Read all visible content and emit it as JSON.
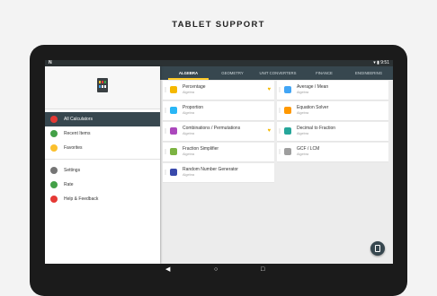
{
  "headline": "TABLET SUPPORT",
  "statusbar": {
    "left": "N",
    "right": "▾ ▮ 9:51"
  },
  "drawer": {
    "items": [
      {
        "label": "All Calculators",
        "icon": "calculator-icon",
        "color": "#e53935"
      },
      {
        "label": "Recent Items",
        "icon": "clock-icon",
        "color": "#43a047"
      },
      {
        "label": "Favorites",
        "icon": "heart-icon",
        "color": "#fbc02d"
      },
      {
        "label": "Settings",
        "icon": "gear-icon",
        "color": "#757575"
      },
      {
        "label": "Rate",
        "icon": "play-store-icon",
        "color": "#43a047"
      },
      {
        "label": "Help & Feedback",
        "icon": "lifebuoy-icon",
        "color": "#e53935"
      }
    ]
  },
  "tabs": [
    "ALGEBRA",
    "GEOMETRY",
    "UNIT CONVERTERS",
    "FINANCE",
    "ENGINEERING"
  ],
  "cards": [
    {
      "title": "Percentage",
      "sub": "Algebra",
      "icon": "percentage-tag-icon",
      "color": "#f5b800",
      "fav": "♥"
    },
    {
      "title": "Average / Mean",
      "sub": "Algebra",
      "icon": "bar-chart-icon",
      "color": "#42a5f5",
      "fav": ""
    },
    {
      "title": "Proportion",
      "sub": "Algebra",
      "icon": "proportion-icon",
      "color": "#29b6f6",
      "fav": ""
    },
    {
      "title": "Equation Solver",
      "sub": "Algebra",
      "icon": "clipboard-icon",
      "color": "#ff9800",
      "fav": ""
    },
    {
      "title": "Combinations / Permutations",
      "sub": "Algebra",
      "icon": "shapes-icon",
      "color": "#ab47bc",
      "fav": "♥"
    },
    {
      "title": "Decimal to Fraction",
      "sub": "Algebra",
      "icon": "decimal-icon",
      "color": "#26a69a",
      "fav": ""
    },
    {
      "title": "Fraction Simplifier",
      "sub": "Algebra",
      "icon": "fraction-icon",
      "color": "#7cb342",
      "fav": ""
    },
    {
      "title": "GCF / LCM",
      "sub": "Algebra",
      "icon": "gcf-icon",
      "color": "#9e9e9e",
      "fav": ""
    },
    {
      "title": "Random Number Generator",
      "sub": "Algebra",
      "icon": "dice-icon",
      "color": "#3949ab",
      "fav": ""
    }
  ]
}
